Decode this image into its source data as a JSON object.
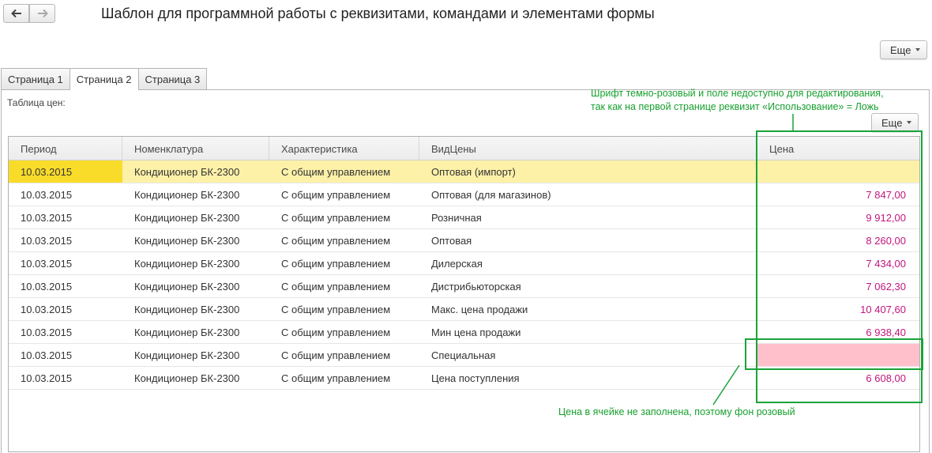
{
  "window": {
    "title": "Шаблон для программной работы с реквизитами, командами и элементами формы",
    "back_icon": "arrow-left-icon",
    "forward_icon": "arrow-right-icon"
  },
  "more_label": "Еще",
  "tabs": [
    {
      "label": "Страница 1",
      "active": false
    },
    {
      "label": "Страница 2",
      "active": true
    },
    {
      "label": "Страница 3",
      "active": false
    }
  ],
  "table": {
    "label": "Таблица цен:",
    "columns": [
      "Период",
      "Номенклатура",
      "Характеристика",
      "ВидЦены",
      "Цена"
    ],
    "rows": [
      {
        "period": "10.03.2015",
        "item": "Кондиционер БК-2300",
        "characteristic": "С общим управлением",
        "price_type": "Оптовая (импорт)",
        "price": ""
      },
      {
        "period": "10.03.2015",
        "item": "Кондиционер БК-2300",
        "characteristic": "С общим управлением",
        "price_type": "Оптовая (для магазинов)",
        "price": "7 847,00"
      },
      {
        "period": "10.03.2015",
        "item": "Кондиционер БК-2300",
        "characteristic": "С общим управлением",
        "price_type": "Розничная",
        "price": "9 912,00"
      },
      {
        "period": "10.03.2015",
        "item": "Кондиционер БК-2300",
        "characteristic": "С общим управлением",
        "price_type": "Оптовая",
        "price": "8 260,00"
      },
      {
        "period": "10.03.2015",
        "item": "Кондиционер БК-2300",
        "characteristic": "С общим управлением",
        "price_type": "Дилерская",
        "price": "7 434,00"
      },
      {
        "period": "10.03.2015",
        "item": "Кондиционер БК-2300",
        "characteristic": "С общим управлением",
        "price_type": "Дистрибьюторская",
        "price": "7 062,30"
      },
      {
        "period": "10.03.2015",
        "item": "Кондиционер БК-2300",
        "characteristic": "С общим управлением",
        "price_type": "Макс. цена продажи",
        "price": "10 407,60"
      },
      {
        "period": "10.03.2015",
        "item": "Кондиционер БК-2300",
        "characteristic": "С общим управлением",
        "price_type": "Мин цена продажи",
        "price": "6 938,40"
      },
      {
        "period": "10.03.2015",
        "item": "Кондиционер БК-2300",
        "characteristic": "С общим управлением",
        "price_type": "Специальная",
        "price": ""
      },
      {
        "period": "10.03.2015",
        "item": "Кондиционер БК-2300",
        "characteristic": "С общим управлением",
        "price_type": "Цена поступления",
        "price": "6 608,00"
      }
    ],
    "selected_row": 0,
    "highlighted_empty_row": 8
  },
  "annotations": {
    "top_line1": "Шрифт темно-розовый и поле недоступно для редактирования,",
    "top_line2": "так как на первой странице реквизит «Использование» = Ложь",
    "bottom": "Цена в ячейке не заполнена, поэтому фон розовый"
  },
  "colors": {
    "price_text": "#c2157e",
    "empty_price_bg": "#ffc0cb",
    "selected_row_bg": "#fdf1a8",
    "selected_cell_bg": "#f9dc2a",
    "annotation": "#17a02e"
  }
}
